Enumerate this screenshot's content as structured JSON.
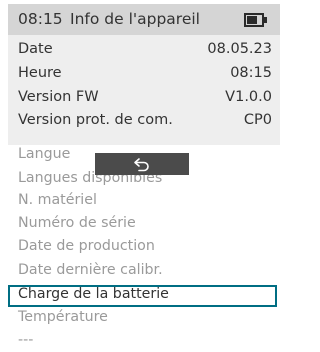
{
  "header": {
    "time": "08:15",
    "title": "Info de l'appareil"
  },
  "details": [
    {
      "label": "Date",
      "value": "08.05.23"
    },
    {
      "label": "Heure",
      "value": "08:15"
    },
    {
      "label": "Version FW",
      "value": "V1.0.0"
    },
    {
      "label": "Version prot. de com.",
      "value": "CP0"
    }
  ],
  "menu": [
    "Langue",
    "Langues disponibles",
    "N. matériel",
    "Numéro de série",
    "Date de production",
    "Date dernière calibr.",
    "Charge de la batterie",
    "Température",
    "---"
  ],
  "icons": {
    "battery": "battery-icon",
    "back": "back-arrow-icon"
  },
  "colors": {
    "selection": "#006e83",
    "header_bg": "#d5d5d5",
    "details_bg": "#eeeeee",
    "overlay_bg": "#4b4b4b"
  }
}
